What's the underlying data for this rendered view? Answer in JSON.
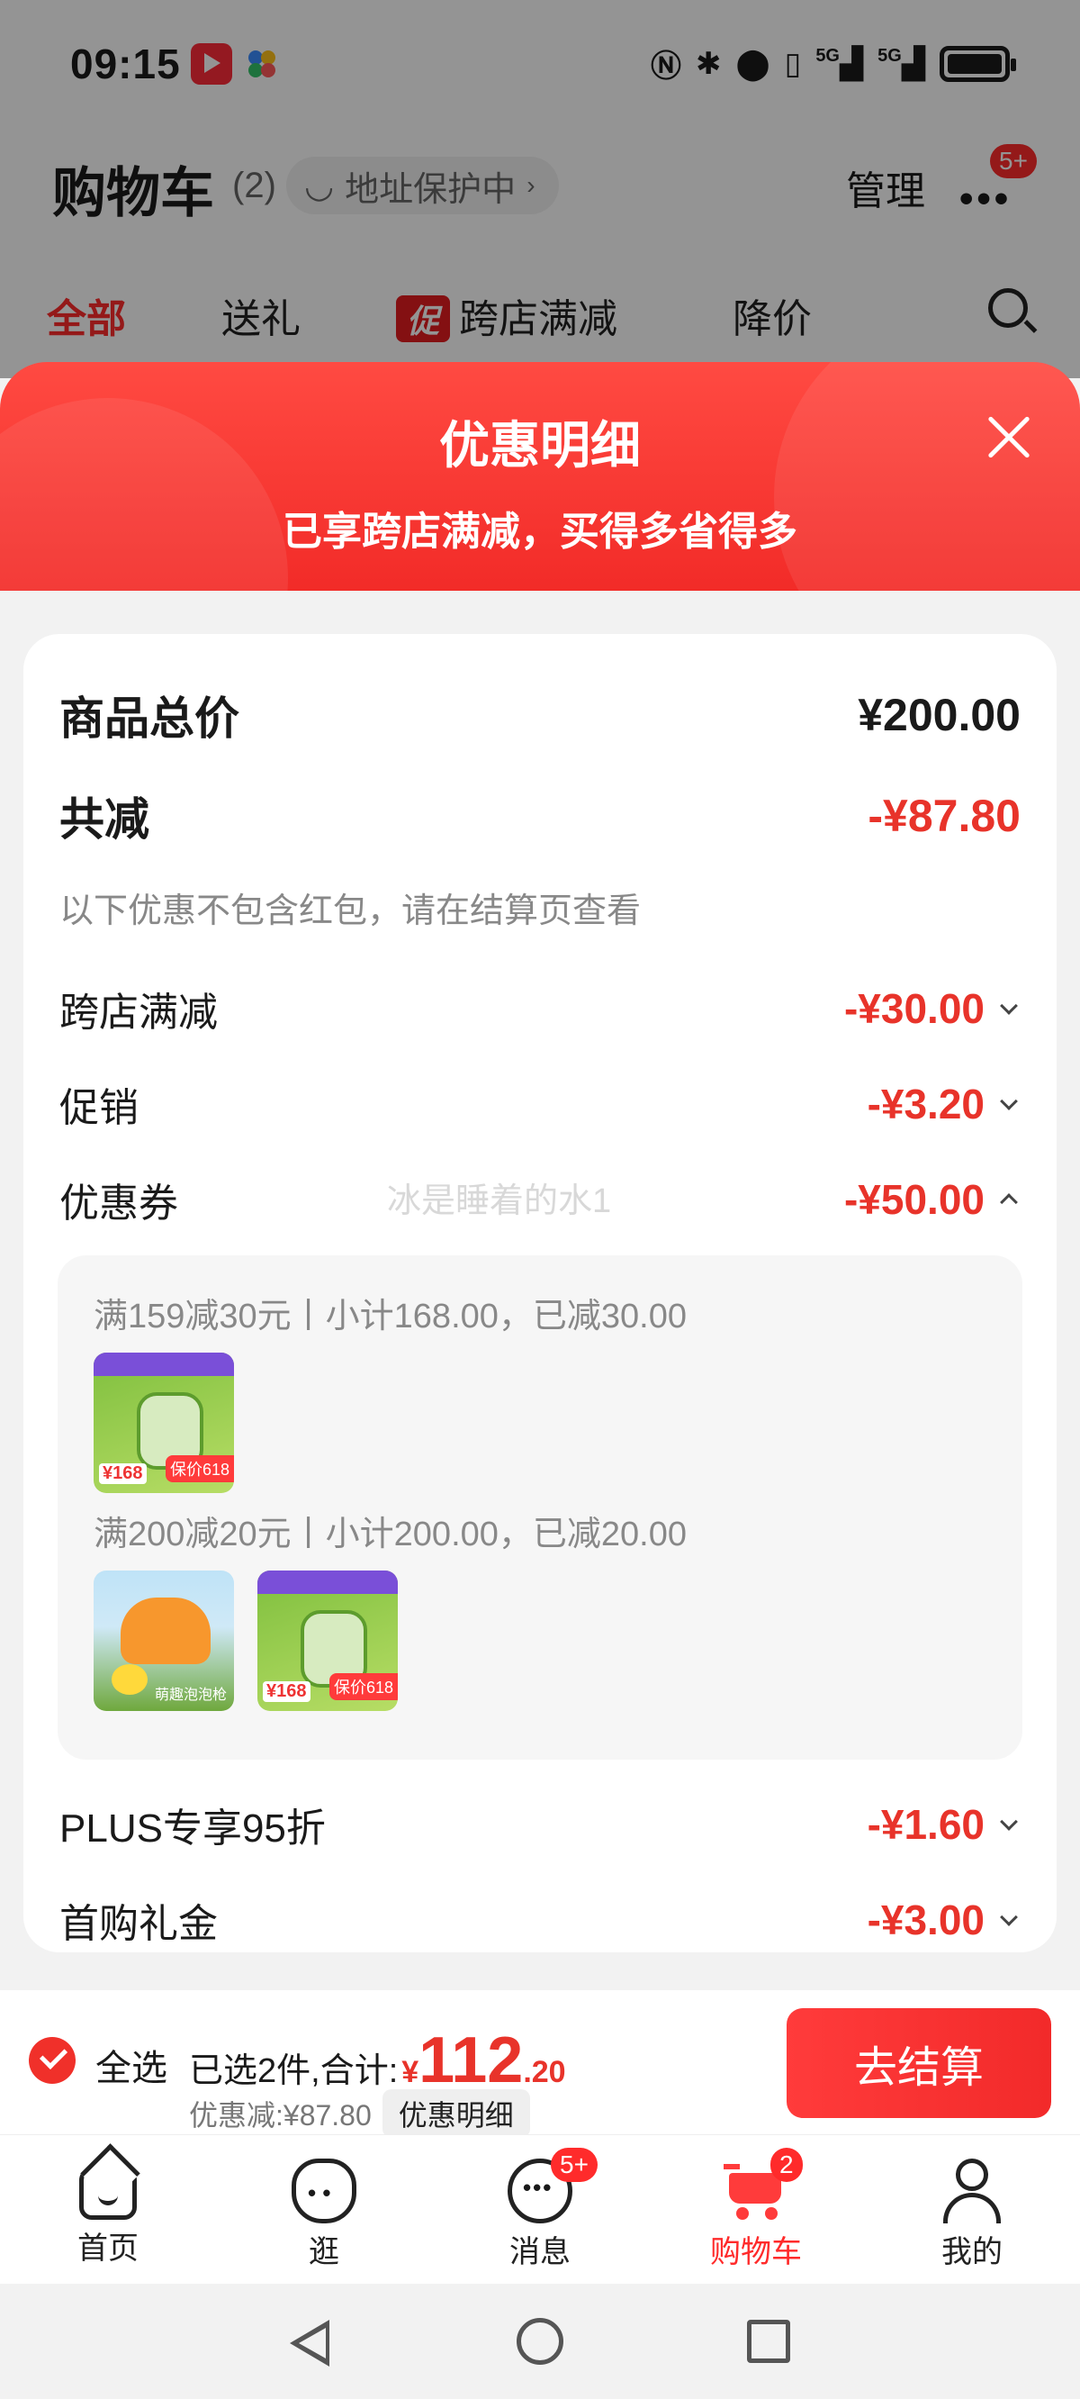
{
  "status_bar": {
    "time": "09:15",
    "network1": "5G",
    "network2": "5G"
  },
  "cart_header": {
    "title": "购物车",
    "count": "(2)",
    "address": "地址保护中",
    "manage": "管理",
    "more_badge": "5+"
  },
  "filter_tabs": [
    "全部",
    "送礼",
    "跨店满减",
    "降价"
  ],
  "promo_tag": "促",
  "panel": {
    "title": "优惠明细",
    "subtitle": "已享跨店满减，买得多省得多",
    "total_label": "商品总价",
    "total_value": "¥200.00",
    "discount_label": "共减",
    "discount_value": "-¥87.80",
    "note": "以下优惠不包含红包，请在结算页查看",
    "items": [
      {
        "label": "跨店满减",
        "value": "-¥30.00"
      },
      {
        "label": "促销",
        "value": "-¥3.20"
      },
      {
        "label": "优惠券",
        "value": "-¥50.00"
      },
      {
        "label": "PLUS专享95折",
        "value": "-¥1.60"
      },
      {
        "label": "首购礼金",
        "value": "-¥3.00"
      }
    ],
    "watermark": "冰是睡着的水1",
    "coupons": [
      {
        "text": "满159减30元丨小计168.00，已减30.00"
      },
      {
        "text": "满200减20元丨小计200.00，已减20.00"
      }
    ],
    "thumb_texts": {
      "price": "¥168",
      "tag": "保价618",
      "caption": "萌趣泡泡枪"
    }
  },
  "checkout": {
    "select_all": "全选",
    "selected_prefix": "已选2件,合计:",
    "yen": "¥",
    "amount_int": "112",
    "amount_dec": ".20",
    "discount_text": "优惠减:¥87.80",
    "detail_chip": "优惠明细",
    "pay_button": "去结算"
  },
  "tabbar": [
    {
      "label": "首页"
    },
    {
      "label": "逛"
    },
    {
      "label": "消息",
      "badge": "5+"
    },
    {
      "label": "购物车",
      "badge": "2"
    },
    {
      "label": "我的"
    }
  ],
  "colors": {
    "accent": "#ff2b2b",
    "price_red": "#e8332a",
    "header_red": "#f22b28"
  }
}
